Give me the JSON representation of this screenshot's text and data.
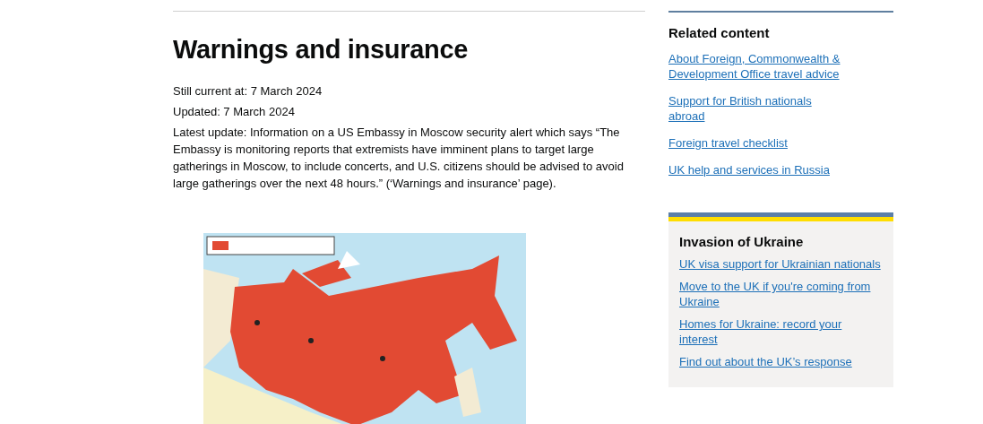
{
  "main": {
    "heading": "Warnings and insurance",
    "meta": [
      "Still current at: 7 March 2024",
      "Updated: 7 March 2024",
      "Latest update: Information on a US Embassy in Moscow security alert which says “The Embassy is monitoring reports that extremists have imminent plans to target large gatherings in Moscow, to include concerts, and U.S. citizens should be advised to avoid large gatherings over the next 48 hours.” (‘Warnings and insurance’ page)."
    ],
    "map": {
      "kind": "picture"
    }
  },
  "related": {
    "title": "Related content",
    "links": [
      "About Foreign, Commonwealth & Development Office travel advice",
      "Support for British nationals abroad",
      "Foreign travel checklist",
      "UK help and services in Russia"
    ]
  },
  "ukraine": {
    "title": "Invasion of Ukraine",
    "links": [
      "UK visa support for Ukrainian nationals",
      "Move to the UK if you're coming from Ukraine",
      "Homes for Ukraine: record your interest",
      "Find out about the UK’s response"
    ]
  }
}
